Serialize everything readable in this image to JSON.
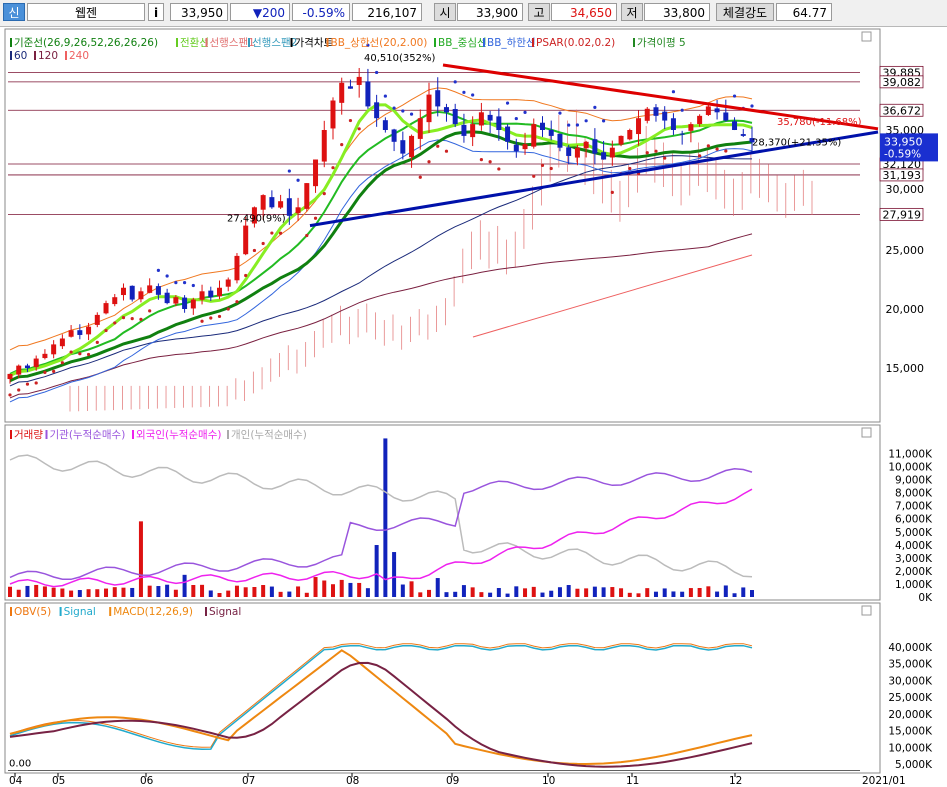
{
  "toolbar": {
    "type_label": "신",
    "name": "웹젠",
    "info_icon": "i",
    "price": "33,950",
    "change": "▼200",
    "change_pct": "-0.59%",
    "volume": "216,107",
    "open_label": "시",
    "open": "33,900",
    "high_label": "고",
    "high": "34,650",
    "low_label": "저",
    "low": "33,800",
    "strength_label": "체결강도",
    "strength": "64.77"
  },
  "colors": {
    "up": "#dd1111",
    "down": "#1122bb",
    "bb_upper": "#f07820",
    "bb_mid": "#22bb22",
    "bb_lower": "#3366dd",
    "psar": "#cc2222",
    "base_line": "#108010",
    "conv_line": "#88ee22",
    "ichimoku_cloud": "#e07070",
    "ma60": "#1a2a7a",
    "ma120": "#7a2040",
    "ma240": "#ee6060",
    "resistance": "#dd0000",
    "support": "#0011aa",
    "foreign": "#ee22ee",
    "institution": "#9955dd",
    "retail": "#bbbbbb",
    "obv": "#ee7711",
    "obv_signal": "#22aacc",
    "macd": "#ee8811",
    "macd_signal": "#772244"
  },
  "price_panel": {
    "legend1": [
      {
        "text": "기준선(26,9,26,52,26,26,26)",
        "color": "#108010"
      },
      {
        "text": "전환선",
        "color": "#66cc22"
      },
      {
        "text": "선행스팬1",
        "color": "#e07070"
      },
      {
        "text": "선행스팬2",
        "color": "#3399bb"
      },
      {
        "text": "가격차트",
        "color": "#000000"
      },
      {
        "text": "BB_상한선(20,2.00)",
        "color": "#f07820"
      },
      {
        "text": "BB_중심선",
        "color": "#22aa22"
      },
      {
        "text": "BB_하한선",
        "color": "#3366dd"
      },
      {
        "text": "PSAR(0.02,0.2)",
        "color": "#cc2222"
      },
      {
        "text": "가격이평 5",
        "color": "#228822"
      }
    ],
    "legend2": [
      {
        "text": "60",
        "color": "#1a2a7a"
      },
      {
        "text": "120",
        "color": "#7a2040"
      },
      {
        "text": "240",
        "color": "#ee6060"
      }
    ],
    "max_annotation": "40,510(352%)",
    "min_annotation": "27,490(9%)",
    "target_annotation": "35,780(-11.68%)",
    "support_annotation": "28,370(+21.35%)",
    "price_tags": [
      {
        "value": 39885,
        "text": "39,885"
      },
      {
        "value": 39082,
        "text": "39,082"
      },
      {
        "value": 36672,
        "text": "36,672"
      },
      {
        "value": 32120,
        "text": "32,120"
      },
      {
        "value": 31193,
        "text": "31,193"
      },
      {
        "value": 27919,
        "text": "27,919"
      }
    ],
    "current_tag": {
      "value": 33950,
      "text": "33,950",
      "pct": "-0.59%"
    },
    "y_ticks": [
      {
        "value": 35000,
        "text": "35,000"
      },
      {
        "value": 30000,
        "text": "30,000"
      },
      {
        "value": 25000,
        "text": "25,000"
      },
      {
        "value": 20000,
        "text": "20,000"
      },
      {
        "value": 15000,
        "text": "15,000"
      }
    ]
  },
  "volume_panel": {
    "legend": [
      {
        "text": "거래량",
        "color": "#dd1111"
      },
      {
        "text": "기관(누적순매수)",
        "color": "#9955dd"
      },
      {
        "text": "외국인(누적순매수)",
        "color": "#ee22ee"
      },
      {
        "text": "개인(누적순매수)",
        "color": "#aaaaaa"
      }
    ],
    "y_ticks": [
      "11,000K",
      "10,000K",
      "9,000K",
      "8,000K",
      "7,000K",
      "6,000K",
      "5,000K",
      "4,000K",
      "3,000K",
      "2,000K",
      "1,000K",
      "0K"
    ]
  },
  "indicator_panel": {
    "legend": [
      {
        "text": "OBV(5)",
        "color": "#ee7711"
      },
      {
        "text": "Signal",
        "color": "#22aacc"
      },
      {
        "text": "MACD(12,26,9)",
        "color": "#ee8811"
      },
      {
        "text": "Signal",
        "color": "#772244"
      }
    ],
    "zero_label": "0.00",
    "y_ticks": [
      "40,000K",
      "35,000K",
      "30,000K",
      "25,000K",
      "20,000K",
      "15,000K",
      "10,000K",
      "5,000K"
    ]
  },
  "x_axis": {
    "labels": [
      "04",
      "05",
      "06",
      "07",
      "08",
      "09",
      "10",
      "11",
      "12"
    ],
    "end_label": "2021/01"
  },
  "chart_data": {
    "type": "candlestick",
    "title": "",
    "x": [
      "2020-04",
      "2020-05",
      "2020-06",
      "2020-07",
      "2020-08",
      "2020-09",
      "2020-10",
      "2020-11",
      "2020-12"
    ],
    "series": [
      {
        "name": "가격차트",
        "type": "ohlc_monthly",
        "values": [
          {
            "month": "04",
            "open": 14500,
            "high": 18000,
            "low": 13800,
            "close": 17500
          },
          {
            "month": "05",
            "open": 17500,
            "high": 22500,
            "low": 17000,
            "close": 21500
          },
          {
            "month": "06",
            "open": 21500,
            "high": 24000,
            "low": 19500,
            "close": 21000
          },
          {
            "month": "07",
            "open": 21000,
            "high": 31000,
            "low": 20500,
            "close": 28500
          },
          {
            "month": "08",
            "open": 28500,
            "high": 40510,
            "low": 27490,
            "close": 36000
          },
          {
            "month": "09",
            "open": 36000,
            "high": 39900,
            "low": 32000,
            "close": 35500
          },
          {
            "month": "10",
            "open": 35500,
            "high": 36800,
            "low": 31500,
            "close": 33000
          },
          {
            "month": "11",
            "open": 33000,
            "high": 37800,
            "low": 31200,
            "close": 36000
          },
          {
            "month": "12",
            "open": 36000,
            "high": 37500,
            "low": 33800,
            "close": 33950
          }
        ]
      }
    ],
    "ylim": [
      12500,
      42500
    ],
    "annotations": [
      {
        "text": "40,510(352%)",
        "y": 40510
      },
      {
        "text": "27,490(9%)",
        "y": 27490
      },
      {
        "text": "35,780(-11.68%)",
        "y": 35780
      },
      {
        "text": "28,370(+21.35%)",
        "y": 28370
      }
    ]
  }
}
